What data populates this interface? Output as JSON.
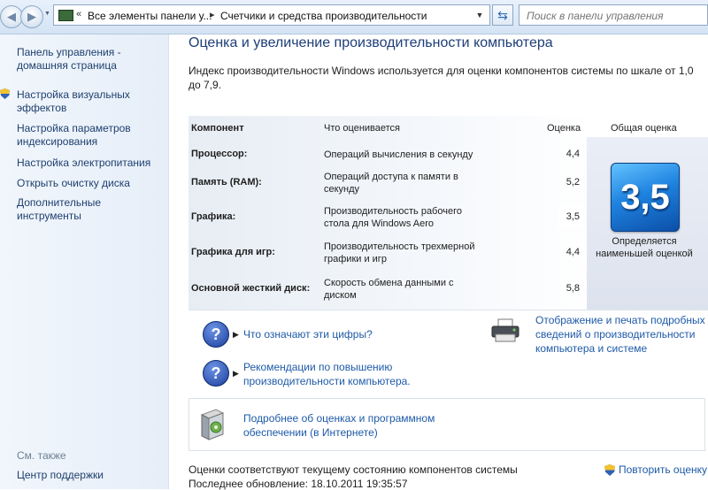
{
  "address": {
    "crumb1": "Все элементы панели у...",
    "crumb2": "Счетчики и средства производительности"
  },
  "search": {
    "placeholder": "Поиск в панели управления"
  },
  "sidebar": {
    "items": [
      "Панель управления - домашняя страница",
      "Настройка визуальных эффектов",
      "Настройка параметров индексирования",
      "Настройка электропитания",
      "Открыть очистку диска",
      "Дополнительные инструменты"
    ],
    "see_also": "См. также",
    "support": "Центр поддержки"
  },
  "main": {
    "title": "Оценка и увеличение производительности компьютера",
    "intro": "Индекс производительности Windows используется для оценки компонентов системы по шкале от 1,0 до 7,9."
  },
  "table": {
    "headers": {
      "component": "Компонент",
      "rated": "Что оценивается",
      "score": "Оценка",
      "overall": "Общая оценка"
    },
    "rows": [
      {
        "name": "Процессор:",
        "desc": "Операций вычисления в секунду",
        "score": "4,4"
      },
      {
        "name": "Память (RAM):",
        "desc": "Операций доступа к памяти в секунду",
        "score": "5,2"
      },
      {
        "name": "Графика:",
        "desc": "Производительность рабочего стола для Windows Aero",
        "score": "3,5"
      },
      {
        "name": "Графика для игр:",
        "desc": "Производительность трехмерной графики и игр",
        "score": "4,4"
      },
      {
        "name": "Основной жесткий диск:",
        "desc": "Скорость обмена данными с диском",
        "score": "5,8"
      }
    ],
    "overall_score": "3,5",
    "overall_caption": "Определяется наименьшей оценкой"
  },
  "links": {
    "numbers": "Что означают эти цифры?",
    "tips": "Рекомендации по повышению производительности компьютера.",
    "print": "Отображение и печать подробных сведений о производительности компьютера и системе",
    "online": "Подробнее об оценках и программном обеспечении (в Интернете)"
  },
  "footer": {
    "status": "Оценки соответствуют текущему состоянию компонентов системы",
    "updated": "Последнее обновление: 18.10.2011 19:35:57",
    "rerun": "Повторить оценку"
  }
}
